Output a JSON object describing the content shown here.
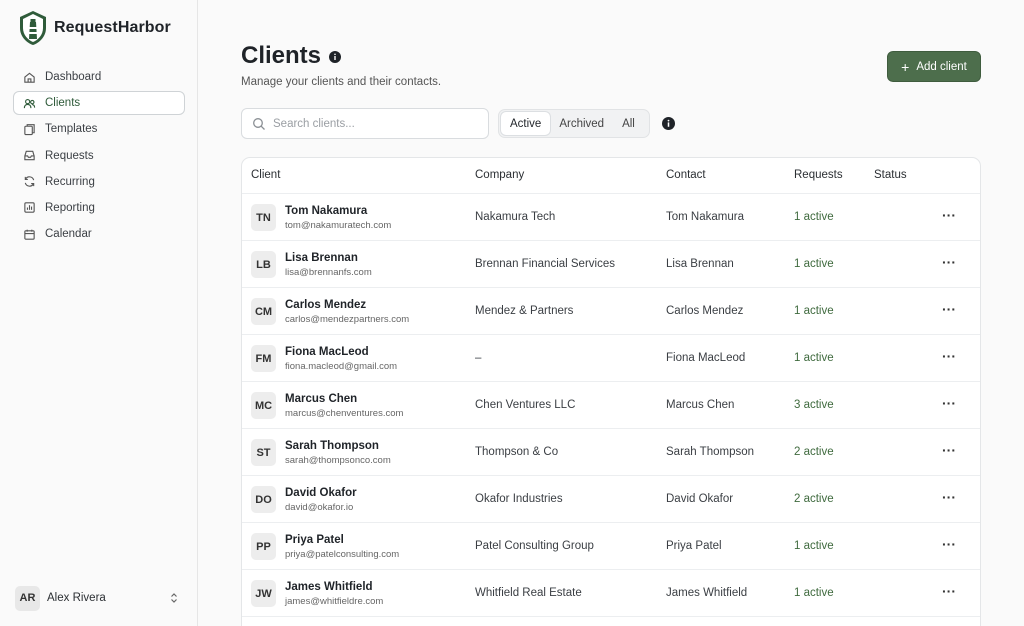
{
  "brand": {
    "name": "RequestHarbor",
    "logo_icon": "lighthouse-logo"
  },
  "sidebar": {
    "items": [
      {
        "label": "Dashboard",
        "icon": "home-icon",
        "active": false
      },
      {
        "label": "Clients",
        "icon": "users-icon",
        "active": true
      },
      {
        "label": "Templates",
        "icon": "templates-icon",
        "active": false
      },
      {
        "label": "Requests",
        "icon": "inbox-icon",
        "active": false
      },
      {
        "label": "Recurring",
        "icon": "refresh-icon",
        "active": false
      },
      {
        "label": "Reporting",
        "icon": "chart-icon",
        "active": false
      },
      {
        "label": "Calendar",
        "icon": "calendar-icon",
        "active": false
      }
    ],
    "user": {
      "initials": "AR",
      "name": "Alex Rivera"
    }
  },
  "header": {
    "title": "Clients",
    "subtitle": "Manage your clients and their contacts.",
    "add_label": "Add client"
  },
  "search": {
    "placeholder": "Search clients...",
    "value": ""
  },
  "filters": {
    "options": [
      "Active",
      "Archived",
      "All"
    ],
    "selected": "Active"
  },
  "table": {
    "columns": [
      "Client",
      "Company",
      "Contact",
      "Requests",
      "Status"
    ],
    "rows": [
      {
        "initials": "TN",
        "name": "Tom Nakamura",
        "email": "tom@nakamuratech.com",
        "company": "Nakamura Tech",
        "contact": "Tom Nakamura",
        "requests": "1 active"
      },
      {
        "initials": "LB",
        "name": "Lisa Brennan",
        "email": "lisa@brennanfs.com",
        "company": "Brennan Financial Services",
        "contact": "Lisa Brennan",
        "requests": "1 active"
      },
      {
        "initials": "CM",
        "name": "Carlos Mendez",
        "email": "carlos@mendezpartners.com",
        "company": "Mendez & Partners",
        "contact": "Carlos Mendez",
        "requests": "1 active"
      },
      {
        "initials": "FM",
        "name": "Fiona MacLeod",
        "email": "fiona.macleod@gmail.com",
        "company": "–",
        "contact": "Fiona MacLeod",
        "requests": "1 active"
      },
      {
        "initials": "MC",
        "name": "Marcus Chen",
        "email": "marcus@chenventures.com",
        "company": "Chen Ventures LLC",
        "contact": "Marcus Chen",
        "requests": "3 active"
      },
      {
        "initials": "ST",
        "name": "Sarah Thompson",
        "email": "sarah@thompsonco.com",
        "company": "Thompson & Co",
        "contact": "Sarah Thompson",
        "requests": "2 active"
      },
      {
        "initials": "DO",
        "name": "David Okafor",
        "email": "david@okafor.io",
        "company": "Okafor Industries",
        "contact": "David Okafor",
        "requests": "2 active"
      },
      {
        "initials": "PP",
        "name": "Priya Patel",
        "email": "priya@patelconsulting.com",
        "company": "Patel Consulting Group",
        "contact": "Priya Patel",
        "requests": "1 active"
      },
      {
        "initials": "JW",
        "name": "James Whitfield",
        "email": "james@whitfieldre.com",
        "company": "Whitfield Real Estate",
        "contact": "James Whitfield",
        "requests": "1 active"
      }
    ]
  },
  "colors": {
    "accent": "#4d6e4c",
    "active_text": "#3f6a3e",
    "sidebar_active": "#2f5b3a"
  }
}
